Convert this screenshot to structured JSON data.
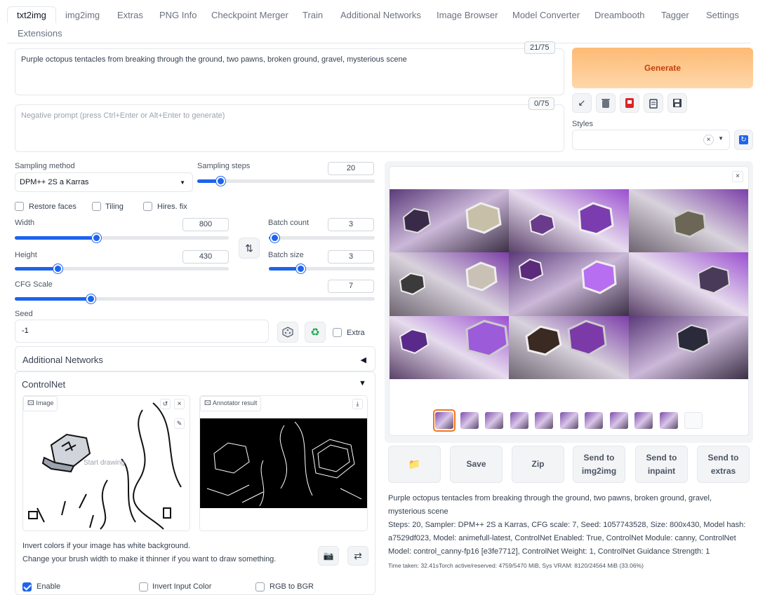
{
  "tabs": [
    "txt2img",
    "img2img",
    "Extras",
    "PNG Info",
    "Checkpoint Merger",
    "Train",
    "Additional Networks",
    "Image Browser",
    "Model Converter",
    "Dreambooth",
    "Tagger",
    "Settings",
    "Extensions"
  ],
  "active_tab": "txt2img",
  "prompt": {
    "value": "Purple octopus tentacles from breaking through the ground, two pawns, broken ground, gravel, mysterious scene",
    "counter": "21/75"
  },
  "negative_prompt": {
    "placeholder": "Negative prompt (press Ctrl+Enter or Alt+Enter to generate)",
    "counter": "0/75"
  },
  "generate_label": "Generate",
  "styles_label": "Styles",
  "sampling": {
    "method_label": "Sampling method",
    "method_value": "DPM++ 2S a Karras",
    "steps_label": "Sampling steps",
    "steps_value": "20",
    "steps_fraction": 0.13
  },
  "checkboxes": {
    "restore_faces": "Restore faces",
    "tiling": "Tiling",
    "hires_fix": "Hires. fix"
  },
  "width": {
    "label": "Width",
    "value": "800",
    "fraction": 0.38
  },
  "height": {
    "label": "Height",
    "value": "430",
    "fraction": 0.2
  },
  "batch_count": {
    "label": "Batch count",
    "value": "3",
    "fraction": 0.05
  },
  "batch_size": {
    "label": "Batch size",
    "value": "3",
    "fraction": 0.3
  },
  "cfg": {
    "label": "CFG Scale",
    "value": "7",
    "fraction": 0.21
  },
  "seed": {
    "label": "Seed",
    "value": "-1",
    "extra_label": "Extra"
  },
  "additional_networks_label": "Additional Networks",
  "controlnet": {
    "title": "ControlNet",
    "image_label": "Image",
    "annotator_label": "Annotator result",
    "start_drawing": "Start drawing",
    "hint_line1": "Invert colors if your image has white background.",
    "hint_line2": "Change your brush width to make it thinner if you want to draw something.",
    "enable_label": "Enable",
    "invert_label": "Invert Input Color",
    "rgb_label": "RGB to BGR"
  },
  "output_buttons": [
    {
      "label": "",
      "icon": "folder-icon"
    },
    {
      "label": "Save"
    },
    {
      "label": "Zip"
    },
    {
      "label": "Send to img2img"
    },
    {
      "label": "Send to inpaint"
    },
    {
      "label": "Send to extras"
    }
  ],
  "info": {
    "prompt_text": "Purple octopus tentacles from breaking through the ground, two pawns, broken ground, gravel, mysterious scene",
    "params_text": "Steps: 20, Sampler: DPM++ 2S a Karras, CFG scale: 7, Seed: 1057743528, Size: 800x430, Model hash: a7529df023, Model: animefull-latest, ControlNet Enabled: True, ControlNet Module: canny, ControlNet Model: control_canny-fp16 [e3fe7712], ControlNet Weight: 1, ControlNet Guidance Strength: 1",
    "time_text": "Time taken: 32.41sTorch active/reserved: 4759/5470 MiB, Sys VRAM: 8120/24564 MiB (33.06%)"
  },
  "colors": {
    "accent": "#1d63ed",
    "generate_from": "#fdba74",
    "generate_to": "#fed7aa",
    "generate_text": "#c2410c",
    "selected_thumb": "#f97316"
  }
}
